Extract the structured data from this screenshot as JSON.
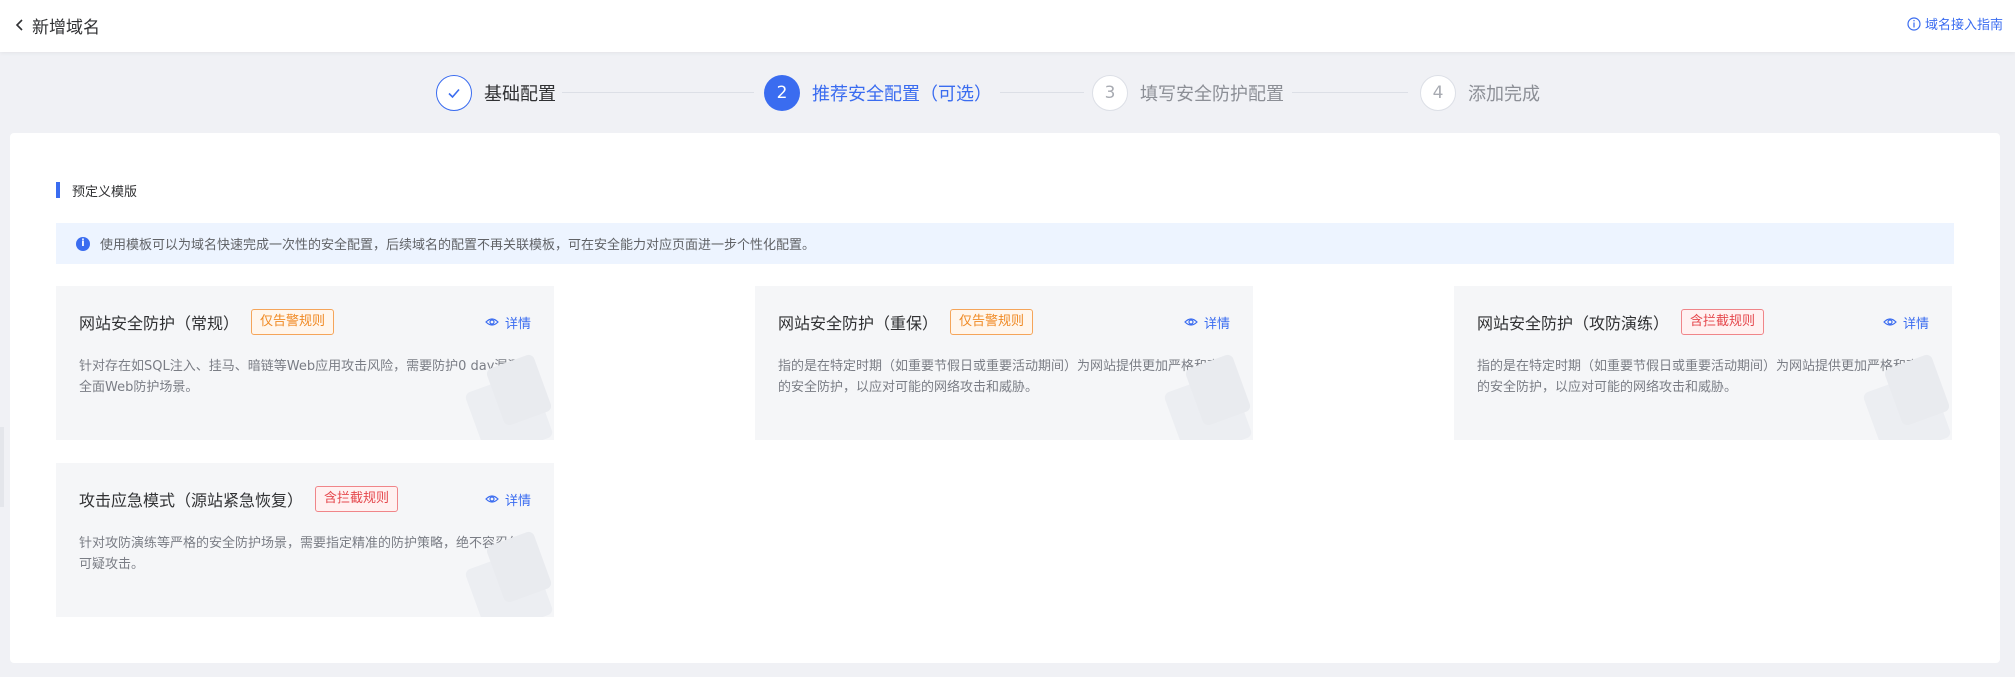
{
  "header": {
    "back_title": "新增域名",
    "guide_link": "域名接入指南"
  },
  "steps": [
    {
      "number": "",
      "label": "基础配置",
      "state": "done"
    },
    {
      "number": "2",
      "label": "推荐安全配置（可选）",
      "state": "active"
    },
    {
      "number": "3",
      "label": "填写安全防护配置",
      "state": "todo"
    },
    {
      "number": "4",
      "label": "添加完成",
      "state": "todo"
    }
  ],
  "section": {
    "title": "预定义模版",
    "notice": "使用模板可以为域名快速完成一次性的安全配置，后续域名的配置不再关联模板，可在安全能力对应页面进一步个性化配置。"
  },
  "templates": [
    {
      "title": "网站安全防护（常规）",
      "tag": "仅告警规则",
      "tag_type": "warn",
      "detail": "详情",
      "desc": "针对存在如SQL注入、挂马、暗链等Web应用攻击风险，需要防护0 day漏洞的全面Web防护场景。"
    },
    {
      "title": "网站安全防护（重保）",
      "tag": "仅告警规则",
      "tag_type": "warn",
      "detail": "详情",
      "desc": "指的是在特定时期（如重要节假日或重要活动期间）为网站提供更加严格和高效的安全防护，以应对可能的网络攻击和威胁。"
    },
    {
      "title": "网站安全防护（攻防演练）",
      "tag": "含拦截规则",
      "tag_type": "block",
      "detail": "详情",
      "desc": "指的是在特定时期（如重要节假日或重要活动期间）为网站提供更加严格和高效的安全防护，以应对可能的网络攻击和威胁。"
    },
    {
      "title": "攻击应急模式（源站紧急恢复）",
      "tag": "含拦截规则",
      "tag_type": "block",
      "detail": "详情",
      "desc": "针对攻防演练等严格的安全防护场景，需要指定精准的防护策略，绝不容忍任何可疑攻击。"
    }
  ],
  "colors": {
    "accent": "#3a6cf0",
    "warn": "#f08a24",
    "block": "#e5484d"
  },
  "icons": {
    "back": "chevron-left-icon",
    "guide": "info-circle-icon",
    "done_step": "check-icon",
    "notice": "info-icon",
    "detail": "eye-icon"
  }
}
